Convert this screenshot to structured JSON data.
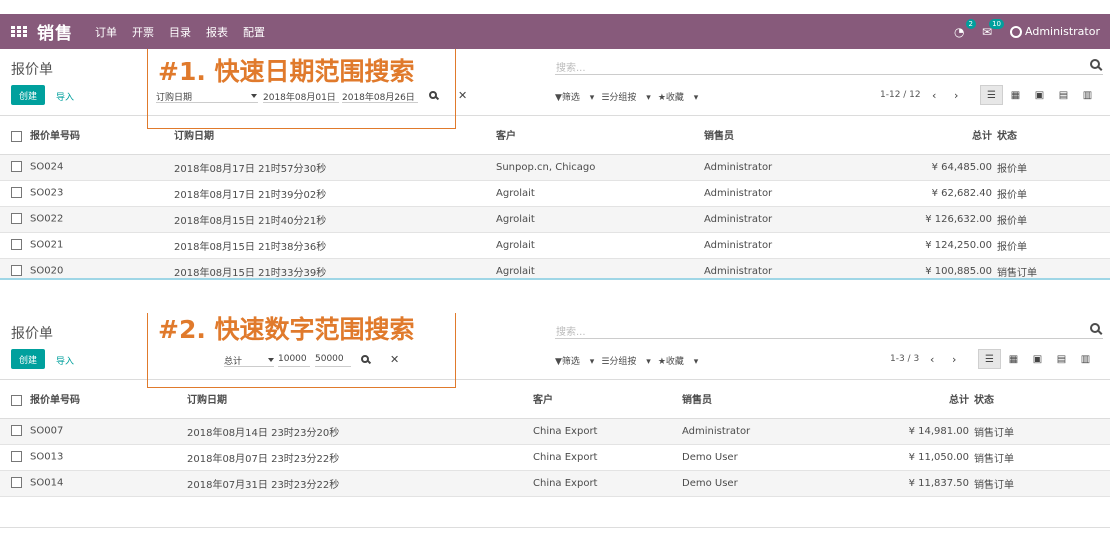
{
  "nav": {
    "brand": "销售",
    "menu": [
      "订单",
      "开票",
      "目录",
      "报表",
      "配置"
    ],
    "activity_badge": "2",
    "messages_badge": "10",
    "user": "Administrator"
  },
  "panel1": {
    "title": "报价单",
    "create_label": "创建",
    "import_label": "导入",
    "search_placeholder": "搜索...",
    "filters_label": "筛选",
    "groupby_label": "分组按",
    "favorites_label": "收藏",
    "pager": "1-12 / 12",
    "range_field": "订购日期",
    "range_from": "2018年08月01日",
    "range_to": "2018年08月26日",
    "callout": "#1. 快速日期范围搜索",
    "columns": [
      "报价单号码",
      "订购日期",
      "客户",
      "销售员",
      "总计",
      "状态"
    ],
    "rows": [
      [
        "SO024",
        "2018年08月17日 21时57分30秒",
        "Sunpop.cn, Chicago",
        "Administrator",
        "¥ 64,485.00",
        "报价单"
      ],
      [
        "SO023",
        "2018年08月17日 21时39分02秒",
        "Agrolait",
        "Administrator",
        "¥ 62,682.40",
        "报价单"
      ],
      [
        "SO022",
        "2018年08月15日 21时40分21秒",
        "Agrolait",
        "Administrator",
        "¥ 126,632.00",
        "报价单"
      ],
      [
        "SO021",
        "2018年08月15日 21时38分36秒",
        "Agrolait",
        "Administrator",
        "¥ 124,250.00",
        "报价单"
      ],
      [
        "SO020",
        "2018年08月15日 21时33分39秒",
        "Agrolait",
        "Administrator",
        "¥ 100,885.00",
        "销售订单"
      ]
    ]
  },
  "panel2": {
    "title": "报价单",
    "create_label": "创建",
    "import_label": "导入",
    "search_placeholder": "搜索...",
    "filters_label": "筛选",
    "groupby_label": "分组按",
    "favorites_label": "收藏",
    "pager": "1-3 / 3",
    "range_field": "总计",
    "range_from": "10000",
    "range_to": "50000",
    "callout": "#2. 快速数字范围搜索",
    "columns": [
      "报价单号码",
      "订购日期",
      "客户",
      "销售员",
      "总计",
      "状态"
    ],
    "rows": [
      [
        "SO007",
        "2018年08月14日 23时23分20秒",
        "China Export",
        "Administrator",
        "¥ 14,981.00",
        "销售订单"
      ],
      [
        "SO013",
        "2018年08月07日 23时23分22秒",
        "China Export",
        "Demo User",
        "¥ 11,050.00",
        "销售订单"
      ],
      [
        "SO014",
        "2018年07月31日 23时23分22秒",
        "China Export",
        "Demo User",
        "¥ 11,837.50",
        "销售订单"
      ]
    ]
  },
  "colors": {
    "nav": "#875a7b",
    "accent": "#00a09d",
    "callout": "#e07a2c"
  }
}
